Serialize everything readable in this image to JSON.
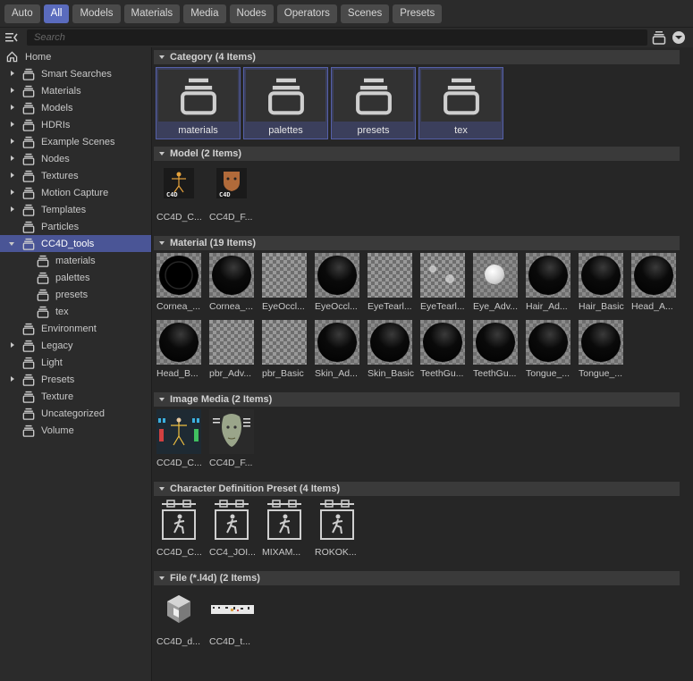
{
  "filters": [
    "Auto",
    "All",
    "Models",
    "Materials",
    "Media",
    "Nodes",
    "Operators",
    "Scenes",
    "Presets"
  ],
  "active_filter": "All",
  "search": {
    "placeholder": "Search"
  },
  "sidebar": {
    "items": [
      {
        "label": "Home",
        "level": 0,
        "arrow": "none",
        "icon": "home-icon"
      },
      {
        "label": "Smart Searches",
        "level": 0,
        "arrow": "right",
        "icon": "folder-icon"
      },
      {
        "label": "Materials",
        "level": 0,
        "arrow": "right",
        "icon": "folder-icon"
      },
      {
        "label": "Models",
        "level": 0,
        "arrow": "right",
        "icon": "folder-icon"
      },
      {
        "label": "HDRIs",
        "level": 0,
        "arrow": "right",
        "icon": "folder-icon"
      },
      {
        "label": "Example Scenes",
        "level": 0,
        "arrow": "right",
        "icon": "folder-icon"
      },
      {
        "label": "Nodes",
        "level": 0,
        "arrow": "right",
        "icon": "folder-icon"
      },
      {
        "label": "Textures",
        "level": 0,
        "arrow": "right",
        "icon": "folder-icon"
      },
      {
        "label": "Motion Capture",
        "level": 0,
        "arrow": "right",
        "icon": "folder-icon"
      },
      {
        "label": "Templates",
        "level": 0,
        "arrow": "right",
        "icon": "folder-icon"
      },
      {
        "label": "Particles",
        "level": 0,
        "arrow": "none",
        "icon": "folder-icon"
      },
      {
        "label": "CC4D_tools",
        "level": 0,
        "arrow": "down",
        "icon": "folder-icon",
        "selected": true
      },
      {
        "label": "materials",
        "level": 1,
        "arrow": "none",
        "icon": "folder-icon"
      },
      {
        "label": "palettes",
        "level": 1,
        "arrow": "none",
        "icon": "folder-icon"
      },
      {
        "label": "presets",
        "level": 1,
        "arrow": "none",
        "icon": "folder-icon"
      },
      {
        "label": "tex",
        "level": 1,
        "arrow": "none",
        "icon": "folder-icon"
      },
      {
        "label": "Environment",
        "level": 0,
        "arrow": "none",
        "icon": "folder-icon"
      },
      {
        "label": "Legacy",
        "level": 0,
        "arrow": "right",
        "icon": "folder-icon"
      },
      {
        "label": "Light",
        "level": 0,
        "arrow": "none",
        "icon": "folder-icon"
      },
      {
        "label": "Presets",
        "level": 0,
        "arrow": "right",
        "icon": "folder-icon"
      },
      {
        "label": "Texture",
        "level": 0,
        "arrow": "none",
        "icon": "folder-icon"
      },
      {
        "label": "Uncategorized",
        "level": 0,
        "arrow": "none",
        "icon": "folder-icon"
      },
      {
        "label": "Volume",
        "level": 0,
        "arrow": "none",
        "icon": "folder-icon"
      }
    ]
  },
  "sections": [
    {
      "title": "Category (4 Items)",
      "kind": "category",
      "items": [
        {
          "label": "materials",
          "thumb": "folder-icon"
        },
        {
          "label": "palettes",
          "thumb": "folder-icon"
        },
        {
          "label": "presets",
          "thumb": "folder-icon"
        },
        {
          "label": "tex",
          "thumb": "folder-icon"
        }
      ]
    },
    {
      "title": "Model (2 Items)",
      "kind": "tiles",
      "items": [
        {
          "label": "CC4D_C...",
          "thumb": "rig-icon"
        },
        {
          "label": "CC4D_F...",
          "thumb": "face-icon"
        }
      ]
    },
    {
      "title": "Material (19 Items)",
      "kind": "tiles",
      "items": [
        {
          "label": "Cornea_...",
          "thumb": "sphere-ring"
        },
        {
          "label": "Cornea_...",
          "thumb": "sphere"
        },
        {
          "label": "EyeOccl...",
          "thumb": "checker"
        },
        {
          "label": "EyeOccl...",
          "thumb": "sphere"
        },
        {
          "label": "EyeTearl...",
          "thumb": "checker"
        },
        {
          "label": "EyeTearl...",
          "thumb": "glow"
        },
        {
          "label": "Eye_Adv...",
          "thumb": "sphere-white"
        },
        {
          "label": "Hair_Ad...",
          "thumb": "sphere"
        },
        {
          "label": "Hair_Basic",
          "thumb": "sphere"
        },
        {
          "label": "Head_A...",
          "thumb": "sphere"
        },
        {
          "label": "Head_B...",
          "thumb": "sphere"
        },
        {
          "label": "pbr_Adv...",
          "thumb": "checker"
        },
        {
          "label": "pbr_Basic",
          "thumb": "checker"
        },
        {
          "label": "Skin_Ad...",
          "thumb": "sphere"
        },
        {
          "label": "Skin_Basic",
          "thumb": "sphere"
        },
        {
          "label": "TeethGu...",
          "thumb": "sphere"
        },
        {
          "label": "TeethGu...",
          "thumb": "sphere"
        },
        {
          "label": "Tongue_...",
          "thumb": "sphere"
        },
        {
          "label": "Tongue_...",
          "thumb": "sphere"
        }
      ]
    },
    {
      "title": "Image Media (2 Items)",
      "kind": "tiles",
      "items": [
        {
          "label": "CC4D_C...",
          "thumb": "image-chart-icon"
        },
        {
          "label": "CC4D_F...",
          "thumb": "image-face-icon"
        }
      ]
    },
    {
      "title": "Character Definition Preset (4 Items)",
      "kind": "tiles",
      "items": [
        {
          "label": "CC4D_C...",
          "thumb": "preset-icon"
        },
        {
          "label": "CC4_JOI...",
          "thumb": "preset-icon"
        },
        {
          "label": "MIXAM...",
          "thumb": "preset-icon"
        },
        {
          "label": "ROKOK...",
          "thumb": "preset-icon"
        }
      ]
    },
    {
      "title": "File (*.l4d) (2 Items)",
      "kind": "tiles",
      "items": [
        {
          "label": "CC4D_d...",
          "thumb": "cube-icon"
        },
        {
          "label": "CC4D_t...",
          "thumb": "strip-icon"
        }
      ]
    }
  ],
  "colors": {
    "accent": "#5a6bbd",
    "selected_row": "#4a5596",
    "category_border": "#5560a8"
  }
}
